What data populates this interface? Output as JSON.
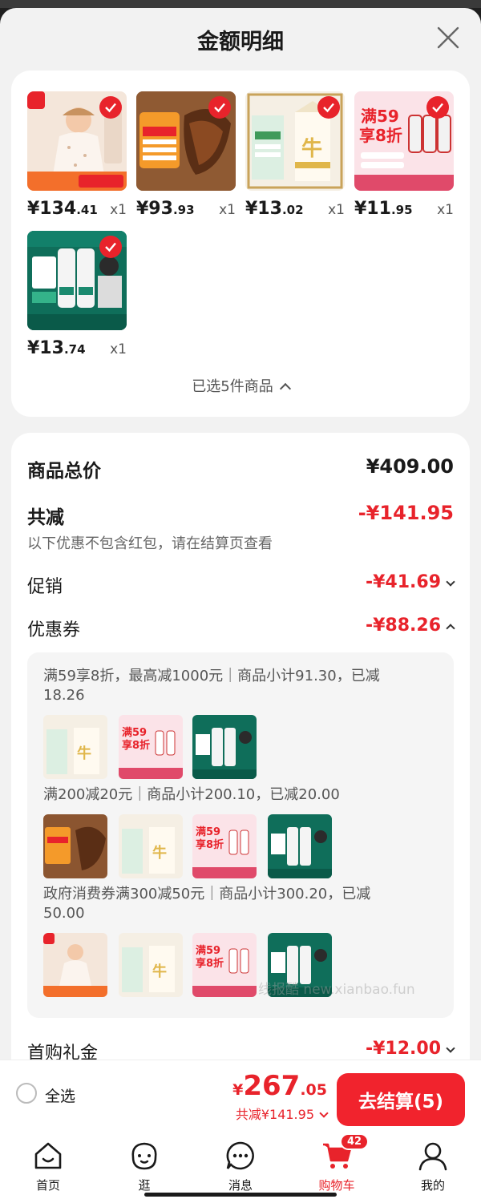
{
  "header": {
    "title": "金额明细",
    "close_icon": "close-icon"
  },
  "products": [
    {
      "price_int": "¥134",
      "price_dec": ".41",
      "qty": "x1",
      "thumb": "kids-sleepsuit"
    },
    {
      "price_int": "¥93",
      "price_dec": ".93",
      "qty": "x1",
      "thumb": "dried-squid"
    },
    {
      "price_int": "¥13",
      "price_dec": ".02",
      "qty": "x1",
      "thumb": "milk-carton"
    },
    {
      "price_int": "¥11",
      "price_dec": ".95",
      "qty": "x1",
      "thumb": "milk-pack"
    },
    {
      "price_int": "¥13",
      "price_dec": ".74",
      "qty": "x1",
      "thumb": "green-milk"
    }
  ],
  "selected_toggle": "已选5件商品",
  "summary": {
    "total_label": "商品总价",
    "total_value": "¥409.00",
    "reduce_label": "共减",
    "reduce_value": "-¥141.95",
    "reduce_note": "以下优惠不包含红包，请在结算页查看",
    "promo_label": "促销",
    "promo_value": "-¥41.69",
    "coupon_label": "优惠券",
    "coupon_value": "-¥88.26",
    "first_label": "首购礼金",
    "first_value": "-¥12.00"
  },
  "coupons": [
    {
      "line1": "满59享8折，最高减1000元｜商品小计91.30，已减",
      "line2": "18.26"
    },
    {
      "line1": "满200减20元｜商品小计200.10，已减20.00",
      "line2": ""
    },
    {
      "line1": "政府消费券满300减50元｜商品小计300.20，已减",
      "line2": "50.00"
    }
  ],
  "bottom": {
    "select_all": "全选",
    "total_yen": "¥",
    "total_int": "267",
    "total_dec": ".05",
    "total_sub": "共减¥141.95",
    "checkout": "去结算(5)"
  },
  "tabs": [
    {
      "label": "首页",
      "icon": "home-icon"
    },
    {
      "label": "逛",
      "icon": "browse-icon"
    },
    {
      "label": "消息",
      "icon": "message-icon"
    },
    {
      "label": "购物车",
      "icon": "cart-icon",
      "badge": "42"
    },
    {
      "label": "我的",
      "icon": "profile-icon"
    }
  ],
  "watermark": "线报酷 new.xianbao.fun",
  "colors": {
    "accent": "#e8232b",
    "background": "#f2f2f2"
  }
}
